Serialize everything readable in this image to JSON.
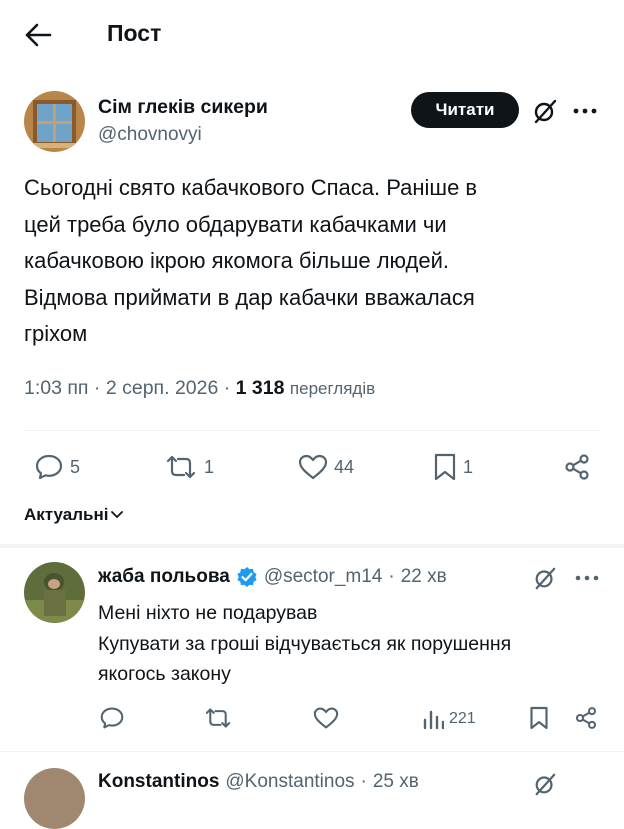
{
  "header": {
    "title": "Пост"
  },
  "post": {
    "author_name": "Сім глеків сикери",
    "handle": "@chovnovyi",
    "follow_label": "Читати",
    "text_lines": [
      "Сьогодні свято кабачкового Спаса. Раніше в",
      "цей треба було обдарувати кабачками чи",
      "кабачковою ікрою якомога більше людей.",
      "Відмова приймати в дар кабачки вважалася",
      "гріхом"
    ],
    "time": "1:03 пп",
    "dot": "·",
    "date": "2 серп. 2026",
    "views_count": "1 318",
    "views_label": "переглядів",
    "stats": {
      "replies": "5",
      "reposts": "1",
      "likes": "44",
      "bookmarks": "1"
    }
  },
  "sort": {
    "label": "Актуальні"
  },
  "reply": {
    "author_name": "жаба польова",
    "handle": "@sector_m14",
    "dot": "·",
    "time": "22 хв",
    "text_lines": [
      "Мені ніхто не подарував",
      "Купувати за гроші відчувається як порушення",
      "якогось закону"
    ],
    "stats": {
      "views": "221"
    }
  },
  "next_reply": {
    "author_name": "Konstantinos",
    "handle": "@Konstantinos",
    "dot": "·",
    "time": "25 хв"
  },
  "colors": {
    "text": "#0f1419",
    "muted": "#536471",
    "verified": "#1d9bf0",
    "divider": "#eff3f4"
  }
}
